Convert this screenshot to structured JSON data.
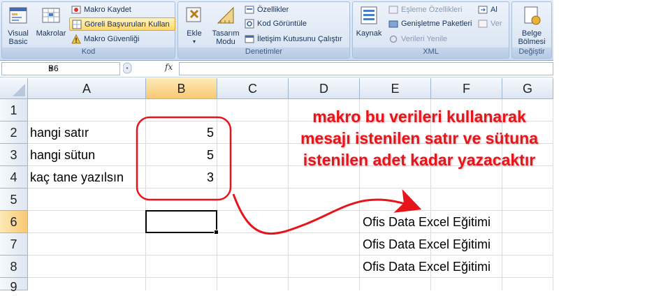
{
  "ribbon": {
    "groups": {
      "kod": "Kod",
      "denetimler": "Denetimler",
      "xml": "XML",
      "degistir": "Değiştir"
    },
    "visual_basic": [
      "Visual",
      "Basic"
    ],
    "makrolar": "Makrolar",
    "makro_kaydet": "Makro Kaydet",
    "goreli": "Göreli Başvuruları Kullan",
    "makro_guvenligi": "Makro Güvenliği",
    "ekle": "Ekle",
    "tasarim_modu": [
      "Tasarım",
      "Modu"
    ],
    "ozellikler": "Özellikler",
    "kod_goruntule": "Kod Görüntüle",
    "iletisim": "İletişim Kutusunu Çalıştır",
    "kaynak": "Kaynak",
    "esleme": "Eşleme Özellikleri",
    "genisletme": "Genişletme Paketleri",
    "verileri_yenile": "Verileri Yenile",
    "al": "Al",
    "ver": "Ver",
    "belge_bolmesi": [
      "Belge",
      "Bölmesi"
    ]
  },
  "formula_bar": {
    "name_box": "B6",
    "fx": "fx"
  },
  "columns": [
    "A",
    "B",
    "C",
    "D",
    "E",
    "F",
    "G"
  ],
  "rows": [
    "1",
    "2",
    "3",
    "4",
    "5",
    "6",
    "7",
    "8",
    "9"
  ],
  "cells": {
    "A2": "hangi satır",
    "A3": "hangi sütun",
    "A4": "kaç tane yazılsın",
    "B2": "5",
    "B3": "5",
    "B4": "3",
    "E6": "Ofis Data Excel Eğitimi",
    "E7": "Ofis Data Excel Eğitimi",
    "E8": "Ofis Data Excel Eğitimi"
  },
  "annotation": {
    "line1": "makro bu verileri kullanarak",
    "line2": "mesajı istenilen satır ve sütuna",
    "line3": "istenilen adet kadar yazacaktır"
  },
  "colors": {
    "annotation": "#e8141b",
    "selection_header": "#f8c972"
  }
}
